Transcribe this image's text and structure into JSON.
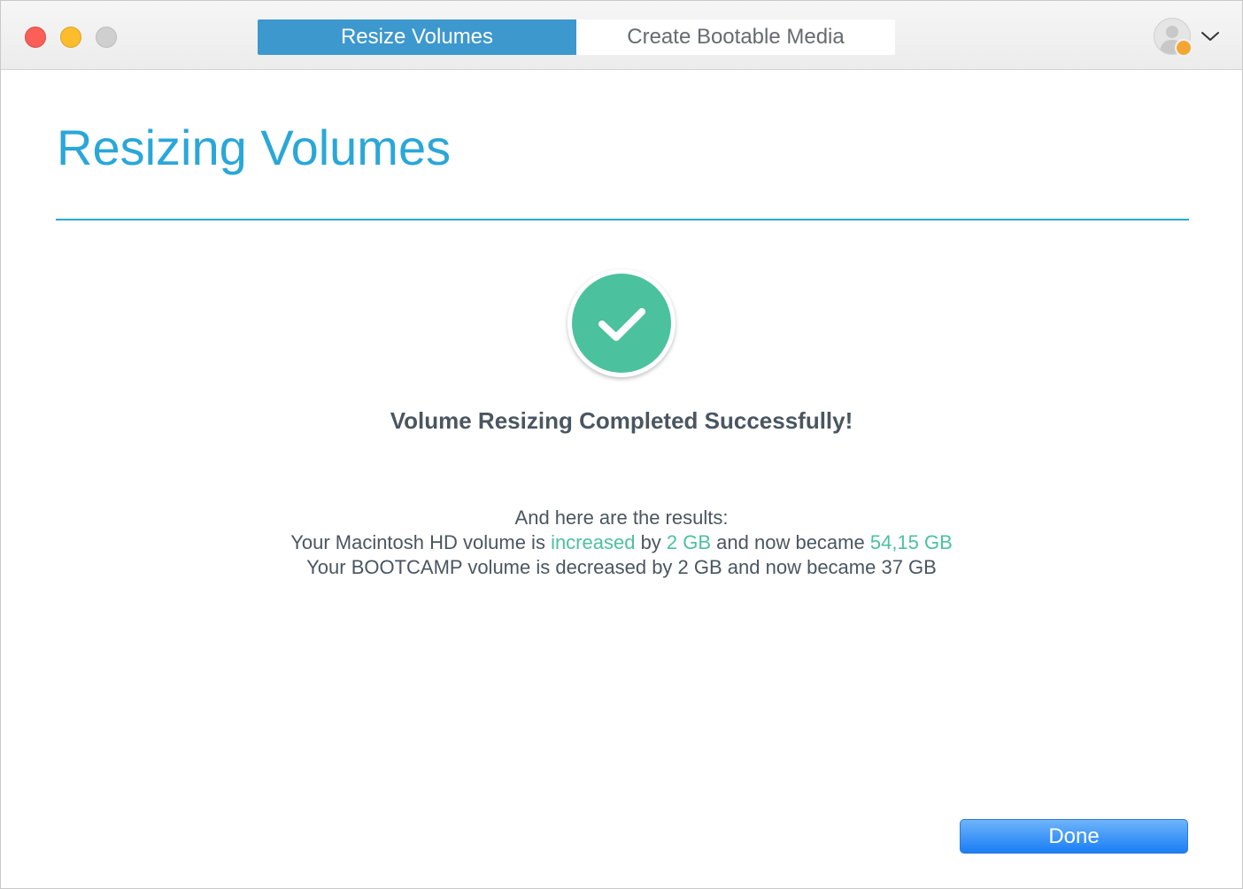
{
  "window": {
    "controls": {
      "close": "close-icon",
      "minimize": "minimize-icon",
      "zoom": "zoom-icon"
    }
  },
  "tabs": [
    {
      "label": "Resize Volumes",
      "active": true
    },
    {
      "label": "Create Bootable Media",
      "active": false
    }
  ],
  "account": {
    "avatar_icon": "user-avatar-icon",
    "badge_color": "#f4a633",
    "menu_icon": "chevron-down-icon"
  },
  "main": {
    "title": "Resizing Volumes",
    "status_icon": "checkmark-icon",
    "headline": "Volume Resizing Completed Successfully!",
    "results": {
      "intro": "And here are the results:",
      "line1": {
        "prefix": "Your Macintosh HD volume is ",
        "verb": "increased",
        "mid1": " by ",
        "amount": "2 GB",
        "mid2": " and now became ",
        "final": "54,15 GB"
      },
      "line2": "Your BOOTCAMP volume is decreased by 2 GB and now became 37 GB"
    },
    "done_label": "Done"
  },
  "colors": {
    "accent": "#2aa7d8",
    "tab_active": "#3d98ce",
    "success": "#4cc19e",
    "button": "#1a7ef5"
  }
}
